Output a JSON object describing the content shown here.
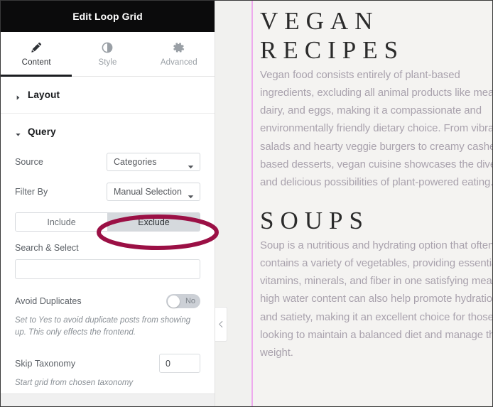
{
  "panel": {
    "title": "Edit Loop Grid",
    "tabs": [
      {
        "label": "Content",
        "icon": "pencil-icon",
        "active": true
      },
      {
        "label": "Style",
        "icon": "contrast-icon",
        "active": false
      },
      {
        "label": "Advanced",
        "icon": "gear-icon",
        "active": false
      }
    ],
    "sections": {
      "layout": {
        "title": "Layout",
        "expanded": false
      },
      "query": {
        "title": "Query",
        "expanded": true,
        "source": {
          "label": "Source",
          "value": "Categories"
        },
        "filter_by": {
          "label": "Filter By",
          "value": "Manual Selection"
        },
        "include_exclude": {
          "options": [
            "Include",
            "Exclude"
          ],
          "selected": "Exclude"
        },
        "search_select": {
          "label": "Search & Select",
          "value": "",
          "placeholder": ""
        },
        "avoid_duplicates": {
          "label": "Avoid Duplicates",
          "value": "No",
          "help": "Set to Yes to avoid duplicate posts from showing up. This only effects the frontend."
        },
        "skip_taxonomy": {
          "label": "Skip Taxonomy",
          "value": "0",
          "help": "Start grid from chosen taxonomy"
        }
      }
    }
  },
  "collapse_handle": {
    "glyph": "‹"
  },
  "preview": {
    "items": [
      {
        "title": "VEGAN RECIPES",
        "title_lines": [
          "VEGAN",
          "RECIPES"
        ],
        "body": "Vegan food consists entirely of plant-based ingredients, excluding all animal products like meat, dairy, and eggs, making it a compassionate and environmentally friendly dietary choice. From vibrant salads and hearty veggie burgers to creamy cashew-based desserts, vegan cuisine showcases the diverse and delicious possibilities of plant-powered eating.",
        "body_lines": [
          "Vegan food consists entirely of plant-based",
          "ingredients, excluding all animal products like meat,",
          "dairy, and eggs, making it a compassionate and",
          "environmentally friendly dietary choice. From vibrant",
          "salads and hearty veggie burgers to creamy cashew-",
          "based desserts, vegan cuisine showcases the diverse",
          "and delicious possibilities of plant-powered eating."
        ]
      },
      {
        "title": "SOUPS",
        "title_lines": [
          "SOUPS"
        ],
        "body": "Soup is a nutritious and hydrating option that often contains a variety of vegetables, providing essential vitamins, minerals, and fiber in one satisfying meal. high water content can also help promote hydration and satiety, making it an excellent choice for those looking to maintain a balanced diet and manage their weight.",
        "body_lines": [
          "Soup is a nutritious and hydrating option that often",
          "contains a variety of vegetables, providing essential",
          "vitamins, minerals, and fiber in one satisfying meal.",
          "high water content can also help promote hydration",
          "and satiety, making it an excellent choice for those",
          "looking to maintain a balanced diet and manage their",
          "weight."
        ]
      }
    ]
  },
  "colors": {
    "header_bg": "#0b0b0c",
    "accent_annotation": "#9b1045",
    "segment_selected_bg": "#d5d9dd",
    "preview_guide_line": "#eeaaee",
    "preview_bg": "#f4f3f1",
    "body_text": "#a9a2ad"
  }
}
